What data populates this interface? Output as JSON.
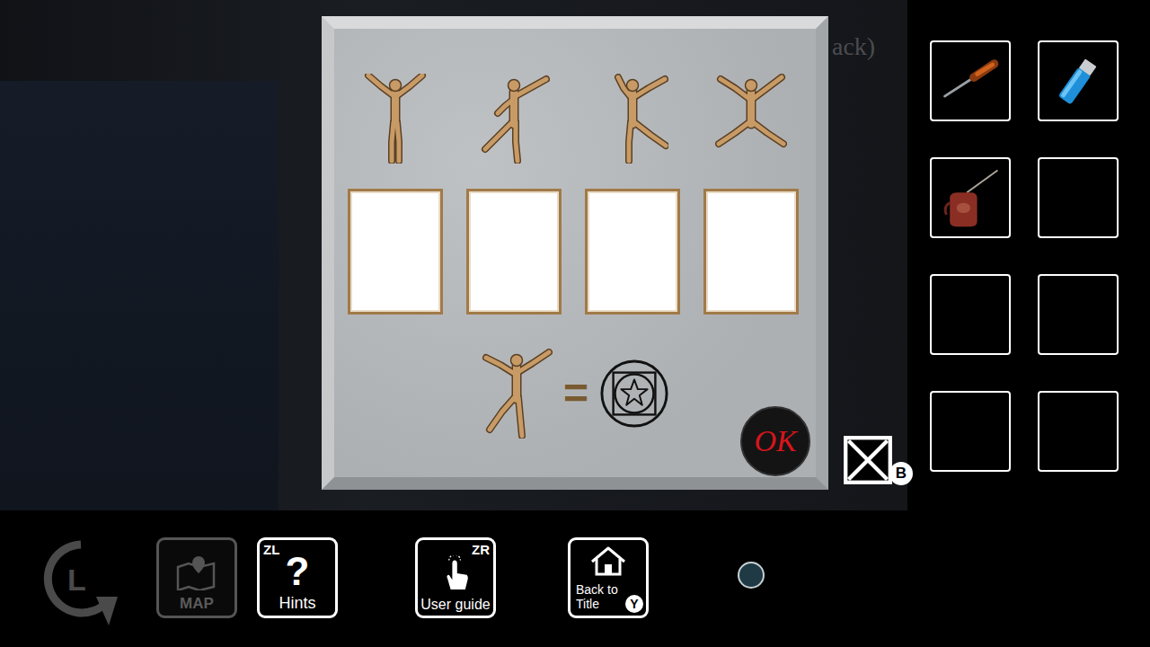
{
  "scene": {
    "background_text": "ack)"
  },
  "puzzle": {
    "poses": [
      {
        "kind": "arms-up"
      },
      {
        "kind": "lunge-left"
      },
      {
        "kind": "kick-right"
      },
      {
        "kind": "split"
      }
    ],
    "slots": [
      {
        "filled": false
      },
      {
        "filled": false
      },
      {
        "filled": false
      },
      {
        "filled": false
      }
    ],
    "clue": {
      "pose": "lunge-reach",
      "equals": "="
    },
    "ok_button": "OK"
  },
  "close_button": {
    "badge": "B"
  },
  "inventory": [
    {
      "kind": "screwdriver"
    },
    {
      "kind": "lighter"
    },
    {
      "kind": "oil-can"
    },
    {
      "kind": "empty"
    },
    {
      "kind": "empty"
    },
    {
      "kind": "empty"
    },
    {
      "kind": "empty"
    },
    {
      "kind": "empty"
    }
  ],
  "toolbar": [
    {
      "kind": "rewind",
      "key": "L",
      "disabled": true
    },
    {
      "kind": "map",
      "label": "MAP",
      "disabled": true
    },
    {
      "kind": "hints",
      "key": "ZL",
      "glyph": "?",
      "label": "Hints",
      "disabled": false
    },
    {
      "kind": "guide",
      "key": "ZR",
      "label": "User guide",
      "disabled": false
    },
    {
      "kind": "title",
      "key": "Y",
      "label_lines": [
        "Back to",
        "Title"
      ],
      "disabled": false
    }
  ]
}
